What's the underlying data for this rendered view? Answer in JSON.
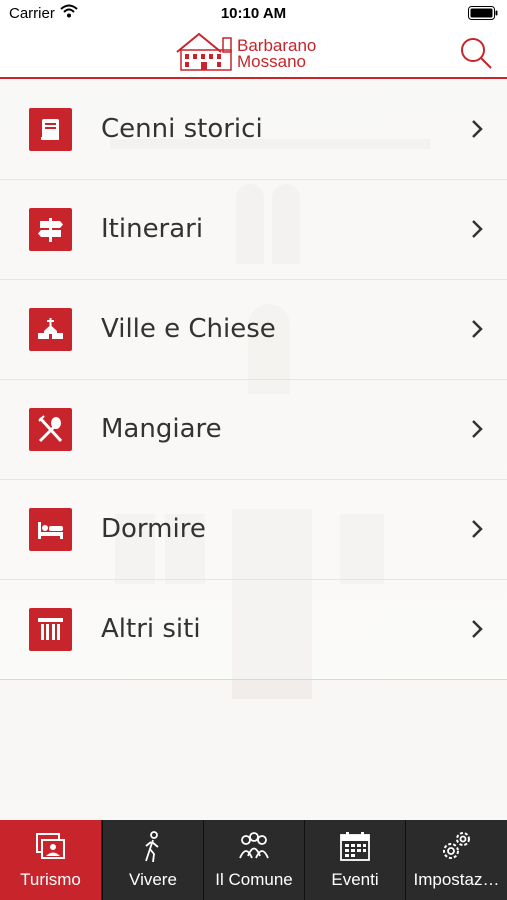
{
  "status_bar": {
    "carrier": "Carrier",
    "time": "10:10 AM"
  },
  "header": {
    "logo_line1": "Barbarano",
    "logo_line2": "Mossano",
    "search_icon": "search-icon",
    "accent_color": "#c8242b"
  },
  "menu": {
    "items": [
      {
        "label": "Cenni storici",
        "icon": "book-icon"
      },
      {
        "label": "Itinerari",
        "icon": "signpost-icon"
      },
      {
        "label": "Ville e Chiese",
        "icon": "church-icon"
      },
      {
        "label": "Mangiare",
        "icon": "fork-spoon-icon"
      },
      {
        "label": "Dormire",
        "icon": "bed-icon"
      },
      {
        "label": "Altri siti",
        "icon": "column-icon"
      }
    ]
  },
  "tabbar": {
    "tabs": [
      {
        "label": "Turismo",
        "icon": "photos-icon",
        "active": true
      },
      {
        "label": "Vivere",
        "icon": "walking-person-icon",
        "active": false
      },
      {
        "label": "Il Comune",
        "icon": "people-group-icon",
        "active": false
      },
      {
        "label": "Eventi",
        "icon": "calendar-icon",
        "active": false
      },
      {
        "label": "Impostaz…",
        "icon": "gears-icon",
        "active": false
      }
    ],
    "background_color": "#2b2b2b",
    "active_color": "#c8242b"
  }
}
